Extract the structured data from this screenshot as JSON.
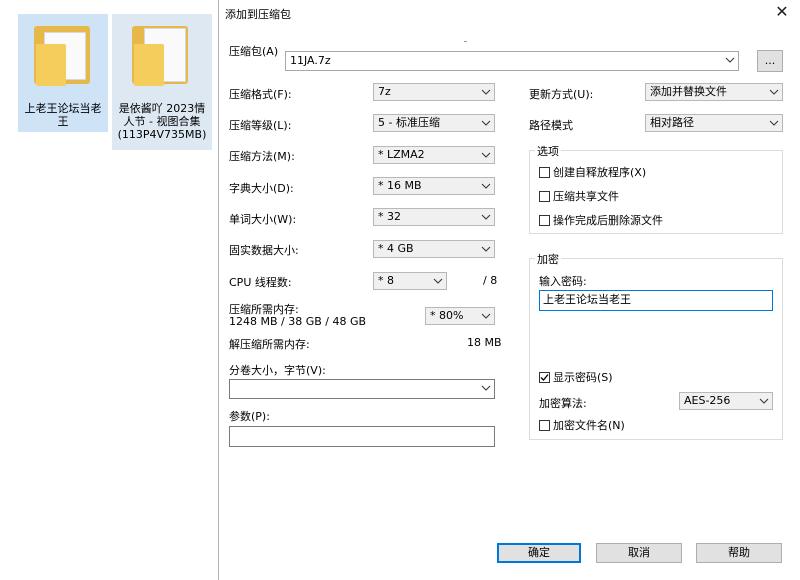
{
  "desktop": {
    "icons": [
      {
        "label": "上老王论坛当老王",
        "line1": "上老王论坛当老",
        "line2": "王"
      },
      {
        "label": "是依酱吖 2023情人节 - 视图合集(113P4V735MB)",
        "line1": "是依酱吖 2023情",
        "line2": "人节 - 视图合集",
        "line3": "(113P4V735MB)"
      }
    ]
  },
  "dialog": {
    "title": "添加到压缩包",
    "close_symbol": "✕",
    "archive_label": "压缩包(A)",
    "archive_value": "11JA.7z",
    "browse_label": "...",
    "format_label": "压缩格式(F):",
    "format_value": "7z",
    "level_label": "压缩等级(L):",
    "level_value": "5 - 标准压缩",
    "method_label": "压缩方法(M):",
    "method_value": "* LZMA2",
    "dict_label": "字典大小(D):",
    "dict_value": "* 16 MB",
    "word_label": "单词大小(W):",
    "word_value": "* 32",
    "solid_label": "固实数据大小:",
    "solid_value": "* 4 GB",
    "cpu_label": "CPU 线程数:",
    "cpu_value": "* 8",
    "cpu_total": "/ 8",
    "mem_comp_label": "压缩所需内存:",
    "mem_comp_detail": "1248 MB / 38 GB / 48 GB",
    "mem_comp_value": "* 80%",
    "mem_decomp_label": "解压缩所需内存:",
    "mem_decomp_value": "18 MB",
    "split_label": "分卷大小，字节(V):",
    "split_value": "",
    "params_label": "参数(P):",
    "params_value": "",
    "update_label": "更新方式(U):",
    "update_value": "添加并替换文件",
    "path_label": "路径模式",
    "path_value": "相对路径",
    "options_title": "选项",
    "opt_sfx": "创建自释放程序(X)",
    "opt_shared": "压缩共享文件",
    "opt_delete": "操作完成后删除源文件",
    "encrypt_title": "加密",
    "password_label": "输入密码:",
    "password_value": "上老王论坛当老王",
    "show_password": "显示密码(S)",
    "enc_method_label": "加密算法:",
    "enc_method_value": "AES-256",
    "encrypt_names": "加密文件名(N)",
    "ok_label": "确定",
    "cancel_label": "取消",
    "help_label": "帮助"
  }
}
